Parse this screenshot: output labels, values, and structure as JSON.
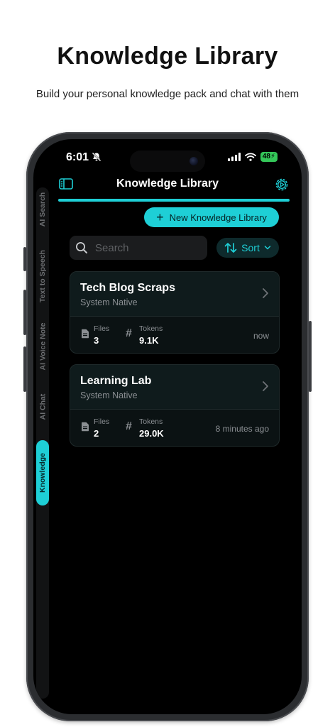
{
  "promo": {
    "title": "Knowledge Library",
    "subtitle": "Build your personal knowledge pack and chat with them"
  },
  "status_bar": {
    "time": "6:01",
    "battery": "48"
  },
  "rail": {
    "tabs": [
      {
        "label": "AI Search",
        "active": false
      },
      {
        "label": "Text to Speech",
        "active": false
      },
      {
        "label": "AI Voice Note",
        "active": false
      },
      {
        "label": "AI Chat",
        "active": false
      },
      {
        "label": "Knowledge",
        "active": true
      }
    ],
    "collapse_glyph": "«"
  },
  "header": {
    "title": "Knowledge Library"
  },
  "toolbar": {
    "new_label": "New Knowledge Library",
    "search_placeholder": "Search",
    "sort_label": "Sort"
  },
  "libraries": [
    {
      "name": "Tech Blog Scraps",
      "source": "System Native",
      "files_label": "Files",
      "files": "3",
      "tokens_label": "Tokens",
      "tokens": "9.1K",
      "updated": "now"
    },
    {
      "name": "Learning Lab",
      "source": "System Native",
      "files_label": "Files",
      "files": "2",
      "tokens_label": "Tokens",
      "tokens": "29.0K",
      "updated": "8 minutes ago"
    }
  ],
  "colors": {
    "accent": "#1ecfd6",
    "background": "#000000",
    "card": "#0f1b1c"
  },
  "icons": [
    "bell-slash-icon",
    "signal-icon",
    "wifi-icon",
    "sidebar-icon",
    "gear-icon",
    "plus-icon",
    "search-icon",
    "sort-icon",
    "chevron-down-icon",
    "chevron-right-icon",
    "file-icon",
    "hash-icon"
  ]
}
